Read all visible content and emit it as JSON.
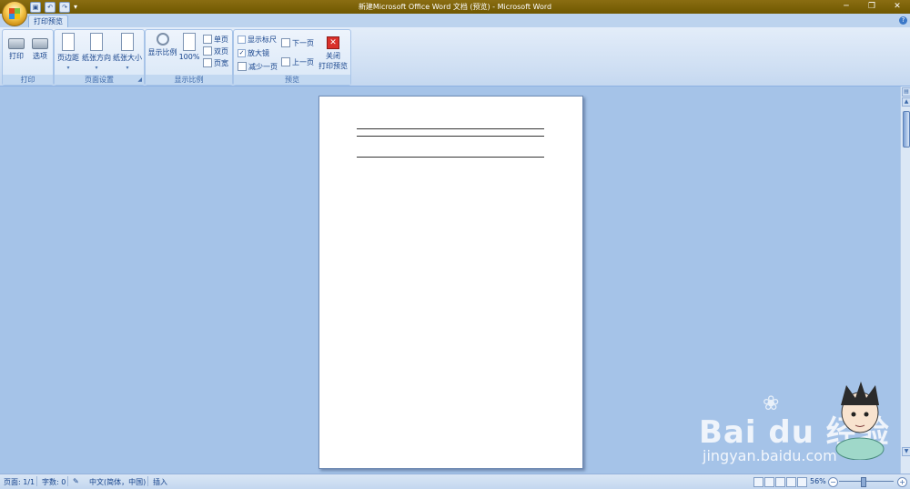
{
  "window": {
    "title": "新建Microsoft Office Word 文档 (预览) - Microsoft Word",
    "controls": {
      "minimize": "─",
      "restore": "❐",
      "close": "✕"
    }
  },
  "quick_access": {
    "save": "▣",
    "undo": "↶",
    "redo": "↷",
    "more": "▾"
  },
  "tabs": [
    {
      "label": "打印预览",
      "active": true
    }
  ],
  "help": "?",
  "ribbon": {
    "groups": [
      {
        "label": "打印",
        "buttons": [
          {
            "label": "打印"
          },
          {
            "label": "选项"
          }
        ]
      },
      {
        "label": "页面设置",
        "buttons": [
          {
            "label": "页边距"
          },
          {
            "label": "纸张方向"
          },
          {
            "label": "纸张大小"
          }
        ]
      },
      {
        "label": "显示比例",
        "buttons": [
          {
            "label": "显示比例"
          },
          {
            "label": "100%"
          }
        ],
        "small": [
          {
            "label": "单页"
          },
          {
            "label": "双页"
          },
          {
            "label": "页宽"
          }
        ]
      },
      {
        "label": "预览",
        "checks": [
          {
            "label": "显示标尺",
            "checked": false
          },
          {
            "label": "放大镜",
            "checked": true
          }
        ],
        "small": [
          {
            "label": "减少一页"
          },
          {
            "label": "下一页"
          },
          {
            "label": "上一页"
          }
        ],
        "close": {
          "line1": "关闭",
          "line2": "打印预览"
        }
      }
    ]
  },
  "status": {
    "page": "页面: 1/1",
    "words": "字数: 0",
    "language": "中文(简体，中国)",
    "mode": "插入",
    "zoom": "56%"
  },
  "watermark": {
    "brand": "Bai du 经验",
    "url": "jingyan.baidu.com"
  }
}
